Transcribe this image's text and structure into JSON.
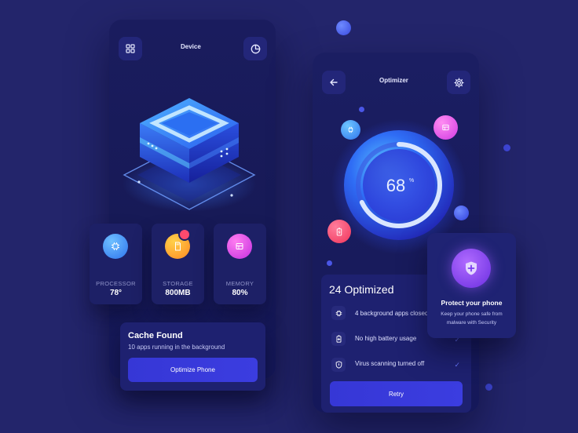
{
  "device_screen": {
    "title": "Device",
    "stats": [
      {
        "label": "PROCESSOR",
        "value": "78°",
        "icon": "chip-icon",
        "color": "#3e8cf5"
      },
      {
        "label": "STORAGE",
        "value": "800MB",
        "icon": "sd-card-icon",
        "color": "#ff9c33"
      },
      {
        "label": "MEMORY",
        "value": "80%",
        "icon": "memory-icon",
        "color": "#d93fe6"
      }
    ],
    "cache": {
      "title": "Cache Found",
      "subtitle": "10 apps running in the background",
      "button_label": "Optimize Phone"
    }
  },
  "optimizer_screen": {
    "title": "Optimizer",
    "gauge": {
      "percent": 68,
      "value_text": "68",
      "unit": "%"
    },
    "summary_title": "24 Optimized",
    "items": [
      {
        "text": "4 background apps closed",
        "icon": "chip-icon",
        "checked": true
      },
      {
        "text": "No high battery usage",
        "icon": "battery-icon",
        "checked": true
      },
      {
        "text": "Virus scanning turned off",
        "icon": "shield-icon",
        "checked": true
      }
    ],
    "button_label": "Retry"
  },
  "protect_card": {
    "title": "Protect your phone",
    "description": "Keep your phone safe from malware with Security",
    "icon": "shield-plus-icon"
  },
  "colors": {
    "background": "#23256b",
    "card": "#1e2170",
    "accent_blue": "#3b3de0",
    "check": "#6a78ff"
  }
}
